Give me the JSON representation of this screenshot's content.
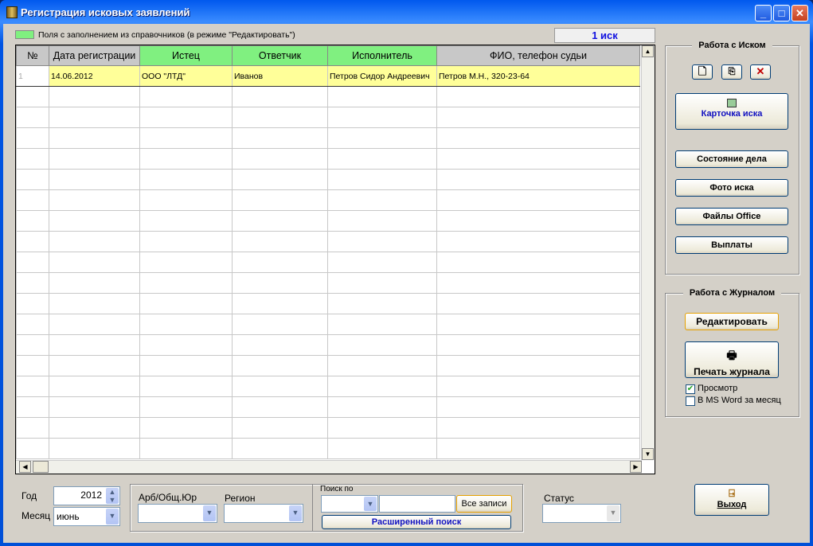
{
  "window": {
    "title": "Регистрация исковых заявлений",
    "min": "_",
    "max": "□",
    "close": "✕"
  },
  "legend": {
    "text": "Поля с заполнением из справочников (в режиме \"Редактировать\")",
    "color": "#80f080"
  },
  "count": "1 иск",
  "grid": {
    "columns": [
      {
        "label": "№",
        "lookup": false
      },
      {
        "label": "Дата регистрации",
        "lookup": false
      },
      {
        "label": "Истец",
        "lookup": true
      },
      {
        "label": "Ответчик",
        "lookup": true
      },
      {
        "label": "Исполнитель",
        "lookup": true
      },
      {
        "label": "ФИО, телефон судьи",
        "lookup": false
      }
    ],
    "rows": [
      [
        "1",
        "14.06.2012",
        "ООО \"ЛТД\"",
        "Иванов",
        "Петров Сидор Андреевич",
        "Петров М.Н., 320-23-64"
      ]
    ],
    "selected_color": "#ffff99"
  },
  "claim_panel": {
    "title": "Работа с Иском",
    "new_icon": "new-document-icon",
    "copy_icon": "copy-icon",
    "delete_icon": "delete-icon",
    "card": "Карточка иска",
    "status": "Состояние дела",
    "photo": "Фото иска",
    "office": "Файлы Office",
    "payments": "Выплаты"
  },
  "journal_panel": {
    "title": "Работа с Журналом",
    "edit": "Редактировать",
    "print": "Печать журнала",
    "preview": {
      "label": "Просмотр",
      "checked": true
    },
    "word": {
      "label": "В MS Word за месяц",
      "checked": false
    }
  },
  "filters": {
    "year_label": "Год",
    "year": "2012",
    "month_label": "Месяц",
    "month": "июнь",
    "arb_label": "Арб/Общ.Юр",
    "arb": "",
    "region_label": "Регион",
    "region": "",
    "search_label": "Поиск по",
    "search_field": "",
    "search_text": "",
    "all_records": "Все записи",
    "advanced": "Расширенный поиск",
    "status_label": "Статус",
    "status": ""
  },
  "exit": "Выход"
}
